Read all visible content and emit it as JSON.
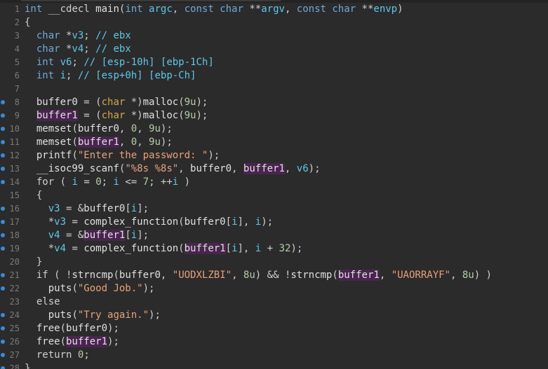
{
  "editor": {
    "lines": [
      {
        "n": "1",
        "bp": false,
        "tokens": [
          {
            "t": "type",
            "v": "int"
          },
          {
            "t": "op",
            "v": " __cdecl "
          },
          {
            "t": "fn",
            "v": "main"
          },
          {
            "t": "op",
            "v": "("
          },
          {
            "t": "type",
            "v": "int"
          },
          {
            "t": "op",
            "v": " "
          },
          {
            "t": "lvar",
            "v": "argc"
          },
          {
            "t": "op",
            "v": ", "
          },
          {
            "t": "type",
            "v": "const char"
          },
          {
            "t": "op",
            "v": " **"
          },
          {
            "t": "lvar",
            "v": "argv"
          },
          {
            "t": "op",
            "v": ", "
          },
          {
            "t": "type",
            "v": "const char"
          },
          {
            "t": "op",
            "v": " **"
          },
          {
            "t": "lvar",
            "v": "envp"
          },
          {
            "t": "op",
            "v": ")"
          }
        ]
      },
      {
        "n": "2",
        "bp": false,
        "tokens": [
          {
            "t": "op",
            "v": "{"
          }
        ]
      },
      {
        "n": "3",
        "bp": false,
        "tokens": [
          {
            "t": "op",
            "v": "  "
          },
          {
            "t": "type",
            "v": "char"
          },
          {
            "t": "op",
            "v": " *"
          },
          {
            "t": "lvar",
            "v": "v3"
          },
          {
            "t": "op",
            "v": "; "
          },
          {
            "t": "cmt",
            "v": "// ebx"
          }
        ]
      },
      {
        "n": "4",
        "bp": false,
        "tokens": [
          {
            "t": "op",
            "v": "  "
          },
          {
            "t": "type",
            "v": "char"
          },
          {
            "t": "op",
            "v": " *"
          },
          {
            "t": "lvar",
            "v": "v4"
          },
          {
            "t": "op",
            "v": "; "
          },
          {
            "t": "cmt",
            "v": "// ebx"
          }
        ]
      },
      {
        "n": "5",
        "bp": false,
        "tokens": [
          {
            "t": "op",
            "v": "  "
          },
          {
            "t": "type",
            "v": "int"
          },
          {
            "t": "op",
            "v": " "
          },
          {
            "t": "lvar",
            "v": "v6"
          },
          {
            "t": "op",
            "v": "; "
          },
          {
            "t": "cmt",
            "v": "// [esp-10h] [ebp-1Ch]"
          }
        ]
      },
      {
        "n": "6",
        "bp": false,
        "tokens": [
          {
            "t": "op",
            "v": "  "
          },
          {
            "t": "type",
            "v": "int"
          },
          {
            "t": "op",
            "v": " "
          },
          {
            "t": "lvar",
            "v": "i"
          },
          {
            "t": "op",
            "v": "; "
          },
          {
            "t": "cmt",
            "v": "// [esp+0h] [ebp-Ch]"
          }
        ]
      },
      {
        "n": "7",
        "bp": false,
        "tokens": []
      },
      {
        "n": "8",
        "bp": true,
        "tokens": [
          {
            "t": "op",
            "v": "  "
          },
          {
            "t": "gvar",
            "v": "buffer0"
          },
          {
            "t": "op",
            "v": " = ("
          },
          {
            "t": "cast",
            "v": "char"
          },
          {
            "t": "op",
            "v": " *)"
          },
          {
            "t": "fn",
            "v": "malloc"
          },
          {
            "t": "op",
            "v": "("
          },
          {
            "t": "num",
            "v": "9u"
          },
          {
            "t": "op",
            "v": ");"
          }
        ]
      },
      {
        "n": "9",
        "bp": true,
        "tokens": [
          {
            "t": "op",
            "v": "  "
          },
          {
            "t": "gvar",
            "v": "buffer1",
            "hl": true
          },
          {
            "t": "op",
            "v": " = ("
          },
          {
            "t": "cast",
            "v": "char"
          },
          {
            "t": "op",
            "v": " *)"
          },
          {
            "t": "fn",
            "v": "malloc"
          },
          {
            "t": "op",
            "v": "("
          },
          {
            "t": "num",
            "v": "9u"
          },
          {
            "t": "op",
            "v": ");"
          }
        ]
      },
      {
        "n": "10",
        "bp": true,
        "tokens": [
          {
            "t": "op",
            "v": "  "
          },
          {
            "t": "fn",
            "v": "memset"
          },
          {
            "t": "op",
            "v": "("
          },
          {
            "t": "gvar",
            "v": "buffer0"
          },
          {
            "t": "op",
            "v": ", "
          },
          {
            "t": "num",
            "v": "0"
          },
          {
            "t": "op",
            "v": ", "
          },
          {
            "t": "num",
            "v": "9u"
          },
          {
            "t": "op",
            "v": ");"
          }
        ]
      },
      {
        "n": "11",
        "bp": true,
        "tokens": [
          {
            "t": "op",
            "v": "  "
          },
          {
            "t": "fn",
            "v": "memset"
          },
          {
            "t": "op",
            "v": "("
          },
          {
            "t": "gvar",
            "v": "buffer1",
            "hl": true
          },
          {
            "t": "op",
            "v": ", "
          },
          {
            "t": "num",
            "v": "0"
          },
          {
            "t": "op",
            "v": ", "
          },
          {
            "t": "num",
            "v": "9u"
          },
          {
            "t": "op",
            "v": ");"
          }
        ]
      },
      {
        "n": "12",
        "bp": true,
        "tokens": [
          {
            "t": "op",
            "v": "  "
          },
          {
            "t": "fn",
            "v": "printf"
          },
          {
            "t": "op",
            "v": "("
          },
          {
            "t": "str",
            "v": "\"Enter the password: \""
          },
          {
            "t": "op",
            "v": ");"
          }
        ]
      },
      {
        "n": "13",
        "bp": true,
        "tokens": [
          {
            "t": "op",
            "v": "  "
          },
          {
            "t": "fn",
            "v": "__isoc99_scanf"
          },
          {
            "t": "op",
            "v": "("
          },
          {
            "t": "str",
            "v": "\"%8s %8s\""
          },
          {
            "t": "op",
            "v": ", "
          },
          {
            "t": "gvar",
            "v": "buffer0"
          },
          {
            "t": "op",
            "v": ", "
          },
          {
            "t": "gvar",
            "v": "buffer1",
            "hl": true
          },
          {
            "t": "op",
            "v": ", "
          },
          {
            "t": "lvar",
            "v": "v6"
          },
          {
            "t": "op",
            "v": ");"
          }
        ]
      },
      {
        "n": "14",
        "bp": true,
        "tokens": [
          {
            "t": "op",
            "v": "  "
          },
          {
            "t": "kw",
            "v": "for"
          },
          {
            "t": "op",
            "v": " ( "
          },
          {
            "t": "lvar",
            "v": "i"
          },
          {
            "t": "op",
            "v": " = "
          },
          {
            "t": "num",
            "v": "0"
          },
          {
            "t": "op",
            "v": "; "
          },
          {
            "t": "lvar",
            "v": "i"
          },
          {
            "t": "op",
            "v": " <= "
          },
          {
            "t": "num",
            "v": "7"
          },
          {
            "t": "op",
            "v": "; ++"
          },
          {
            "t": "lvar",
            "v": "i"
          },
          {
            "t": "op",
            "v": " )"
          }
        ]
      },
      {
        "n": "15",
        "bp": false,
        "tokens": [
          {
            "t": "op",
            "v": "  {"
          }
        ]
      },
      {
        "n": "16",
        "bp": true,
        "tokens": [
          {
            "t": "op",
            "v": "    "
          },
          {
            "t": "lvar",
            "v": "v3"
          },
          {
            "t": "op",
            "v": " = &"
          },
          {
            "t": "gvar",
            "v": "buffer0"
          },
          {
            "t": "op",
            "v": "["
          },
          {
            "t": "lvar",
            "v": "i"
          },
          {
            "t": "op",
            "v": "];"
          }
        ]
      },
      {
        "n": "17",
        "bp": true,
        "tokens": [
          {
            "t": "op",
            "v": "    *"
          },
          {
            "t": "lvar",
            "v": "v3"
          },
          {
            "t": "op",
            "v": " = "
          },
          {
            "t": "fn",
            "v": "complex_function"
          },
          {
            "t": "op",
            "v": "("
          },
          {
            "t": "gvar",
            "v": "buffer0"
          },
          {
            "t": "op",
            "v": "["
          },
          {
            "t": "lvar",
            "v": "i"
          },
          {
            "t": "op",
            "v": "], "
          },
          {
            "t": "lvar",
            "v": "i"
          },
          {
            "t": "op",
            "v": ");"
          }
        ]
      },
      {
        "n": "18",
        "bp": true,
        "tokens": [
          {
            "t": "op",
            "v": "    "
          },
          {
            "t": "lvar",
            "v": "v4"
          },
          {
            "t": "op",
            "v": " = &"
          },
          {
            "t": "gvar",
            "v": "buffer1",
            "hl": true
          },
          {
            "t": "op",
            "v": "["
          },
          {
            "t": "lvar",
            "v": "i"
          },
          {
            "t": "op",
            "v": "];"
          }
        ]
      },
      {
        "n": "19",
        "bp": true,
        "tokens": [
          {
            "t": "op",
            "v": "    *"
          },
          {
            "t": "lvar",
            "v": "v4"
          },
          {
            "t": "op",
            "v": " = "
          },
          {
            "t": "fn",
            "v": "complex_function"
          },
          {
            "t": "op",
            "v": "("
          },
          {
            "t": "gvar",
            "v": "buffer1",
            "hl": true
          },
          {
            "t": "op",
            "v": "["
          },
          {
            "t": "lvar",
            "v": "i"
          },
          {
            "t": "op",
            "v": "], "
          },
          {
            "t": "lvar",
            "v": "i"
          },
          {
            "t": "op",
            "v": " + "
          },
          {
            "t": "num",
            "v": "32"
          },
          {
            "t": "op",
            "v": ");"
          }
        ]
      },
      {
        "n": "20",
        "bp": false,
        "tokens": [
          {
            "t": "op",
            "v": "  }"
          }
        ]
      },
      {
        "n": "21",
        "bp": true,
        "tokens": [
          {
            "t": "op",
            "v": "  "
          },
          {
            "t": "kw",
            "v": "if"
          },
          {
            "t": "op",
            "v": " ( !"
          },
          {
            "t": "fn",
            "v": "strncmp"
          },
          {
            "t": "op",
            "v": "("
          },
          {
            "t": "gvar",
            "v": "buffer0"
          },
          {
            "t": "op",
            "v": ", "
          },
          {
            "t": "str",
            "v": "\"UODXLZBI\""
          },
          {
            "t": "op",
            "v": ", "
          },
          {
            "t": "num",
            "v": "8u"
          },
          {
            "t": "op",
            "v": ") && !"
          },
          {
            "t": "fn",
            "v": "strncmp"
          },
          {
            "t": "op",
            "v": "("
          },
          {
            "t": "gvar",
            "v": "buffer1",
            "hl": true
          },
          {
            "t": "op",
            "v": ", "
          },
          {
            "t": "str",
            "v": "\"UAORRAYF\""
          },
          {
            "t": "op",
            "v": ", "
          },
          {
            "t": "num",
            "v": "8u"
          },
          {
            "t": "op",
            "v": ") )"
          }
        ]
      },
      {
        "n": "22",
        "bp": true,
        "tokens": [
          {
            "t": "op",
            "v": "    "
          },
          {
            "t": "fn",
            "v": "puts"
          },
          {
            "t": "op",
            "v": "("
          },
          {
            "t": "str",
            "v": "\"Good Job.\""
          },
          {
            "t": "op",
            "v": ");"
          }
        ]
      },
      {
        "n": "23",
        "bp": false,
        "tokens": [
          {
            "t": "op",
            "v": "  "
          },
          {
            "t": "kw",
            "v": "else"
          }
        ]
      },
      {
        "n": "24",
        "bp": true,
        "tokens": [
          {
            "t": "op",
            "v": "    "
          },
          {
            "t": "fn",
            "v": "puts"
          },
          {
            "t": "op",
            "v": "("
          },
          {
            "t": "str",
            "v": "\"Try again.\""
          },
          {
            "t": "op",
            "v": ");"
          }
        ]
      },
      {
        "n": "25",
        "bp": true,
        "tokens": [
          {
            "t": "op",
            "v": "  "
          },
          {
            "t": "fn",
            "v": "free"
          },
          {
            "t": "op",
            "v": "("
          },
          {
            "t": "gvar",
            "v": "buffer0"
          },
          {
            "t": "op",
            "v": ");"
          }
        ]
      },
      {
        "n": "26",
        "bp": true,
        "tokens": [
          {
            "t": "op",
            "v": "  "
          },
          {
            "t": "fn",
            "v": "free"
          },
          {
            "t": "op",
            "v": "("
          },
          {
            "t": "gvar",
            "v": "buffer1",
            "hl": true
          },
          {
            "t": "op",
            "v": ");"
          }
        ]
      },
      {
        "n": "27",
        "bp": true,
        "tokens": [
          {
            "t": "op",
            "v": "  "
          },
          {
            "t": "kw",
            "v": "return"
          },
          {
            "t": "op",
            "v": " "
          },
          {
            "t": "num",
            "v": "0"
          },
          {
            "t": "op",
            "v": ";"
          }
        ]
      },
      {
        "n": "28",
        "bp": true,
        "tokens": [
          {
            "t": "op",
            "v": "}"
          }
        ]
      }
    ]
  },
  "colors": {
    "background": "#2b2b2b",
    "text": "#cfcfcf",
    "type": "#6fa8dc",
    "local_variable": "#5ec8e8",
    "string": "#e9a17a",
    "number": "#b5cea8",
    "highlight": "#4a2450",
    "breakpoint_dot": "#3b8bd6"
  },
  "icons": {
    "breakpoint": "breakpoint-dot-icon"
  }
}
